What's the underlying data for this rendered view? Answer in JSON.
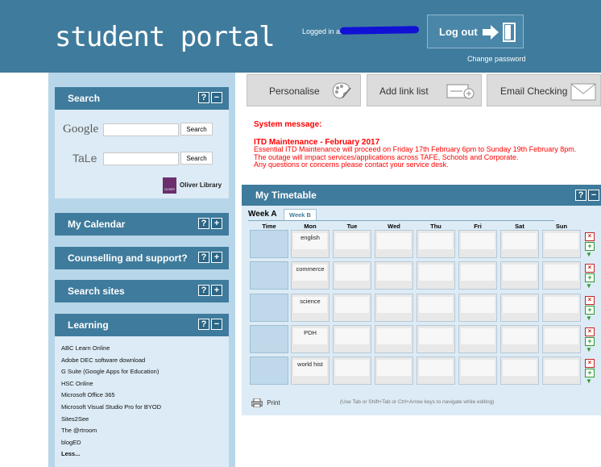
{
  "header": {
    "logo": "student portal",
    "logged_in_label": "Logged in as",
    "logout_label": "Log out",
    "change_password": "Change password"
  },
  "left": {
    "search": {
      "title": "Search",
      "google_logo": "Google",
      "tale_logo": "TaLe",
      "search_button": "Search",
      "oliver_label": "Oliver Library",
      "oliver_icon_text": "OLIVER"
    },
    "calendar_title": "My Calendar",
    "counselling_title": "Counselling and support?",
    "search_sites_title": "Search sites",
    "learning": {
      "title": "Learning",
      "items": [
        "ABC Learn Online",
        "Adobe DEC software download",
        "G Suite (Google Apps for Education)",
        "HSC Online",
        "Microsoft Office 365",
        "Microsoft Visual Studio Pro for BYOD",
        "Sites2See",
        "The @rtroom",
        "blogED",
        "Less..."
      ]
    }
  },
  "toolbar": {
    "personalise": "Personalise",
    "add_link_list": "Add link list",
    "email_checking": "Email Checking"
  },
  "system_message": {
    "label": "System message:",
    "title": "ITD Maintenance - February 2017",
    "lines": [
      "Essential ITD Maintenance will proceed on Friday 17th February 6pm to Sunday 19th February 8pm.",
      "The outage will impact services/applications across TAFE, Schools and Corporate.",
      "Any questions or concerns please contact your service desk."
    ]
  },
  "timetable": {
    "title": "My Timetable",
    "week_a": "Week A",
    "week_b": "Week B",
    "days": [
      "Time",
      "Mon",
      "Tue",
      "Wed",
      "Thu",
      "Fri",
      "Sat",
      "Sun"
    ],
    "subjects": [
      "english",
      "commerce",
      "science",
      "PDH",
      "world hist"
    ],
    "print": "Print",
    "hint": "(Use Tab or Shift+Tab or Ctrl+Arrow keys to navigate while editing)"
  },
  "colors": {
    "header_bg": "#3f7b9c",
    "panel_bg": "#b7d6e9",
    "panel_body": "#dcebf5",
    "alert": "#ff0000",
    "redaction": "#1111d6"
  }
}
